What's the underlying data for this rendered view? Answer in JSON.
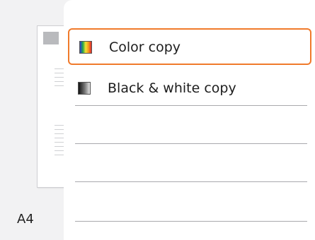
{
  "preview": {
    "paper_size": "A4"
  },
  "options": [
    {
      "label": "Color copy",
      "icon": "color-swatch-icon",
      "selected": true
    },
    {
      "label": "Black & white copy",
      "icon": "grayscale-swatch-icon",
      "selected": false
    }
  ],
  "colors": {
    "selection_border": "#f07a2b",
    "panel_bg": "#ffffff",
    "screen_bg": "#f2f2f3"
  }
}
